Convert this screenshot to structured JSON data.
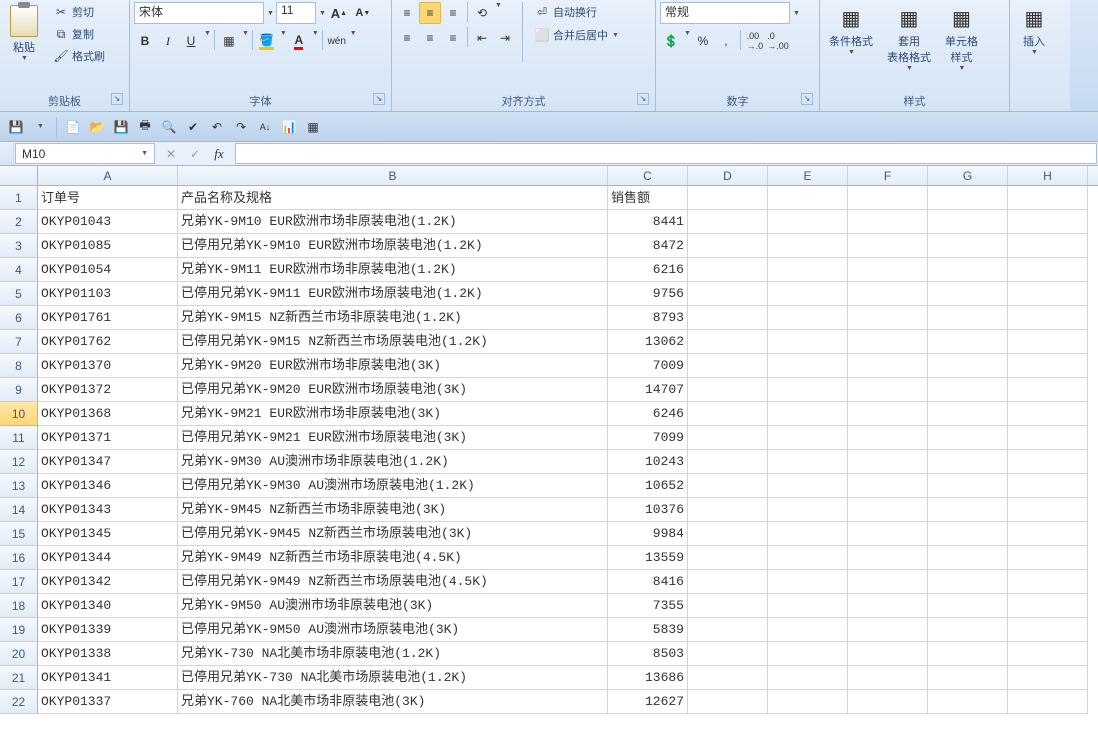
{
  "ribbon": {
    "clipboard": {
      "label": "剪贴板",
      "paste": "粘贴",
      "cut": "剪切",
      "copy": "复制",
      "format_painter": "格式刷"
    },
    "font": {
      "label": "字体",
      "name": "宋体",
      "size": "11"
    },
    "alignment": {
      "label": "对齐方式",
      "wrap": "自动换行",
      "merge": "合并后居中"
    },
    "number": {
      "label": "数字",
      "format": "常规"
    },
    "styles": {
      "label": "样式",
      "cond": "条件格式",
      "table": "套用\n表格格式",
      "cell": "单元格\n样式"
    },
    "insert": {
      "label": "插入"
    }
  },
  "namebox": "M10",
  "columns": [
    "A",
    "B",
    "C",
    "D",
    "E",
    "F",
    "G",
    "H"
  ],
  "selected_row": 10,
  "selected_col": -1,
  "rows": [
    {
      "n": 1,
      "a": "订单号",
      "b": "产品名称及规格",
      "c": "销售额",
      "c_num": false
    },
    {
      "n": 2,
      "a": "OKYP01043",
      "b": "兄弟YK-9M10 EUR欧洲市场非原装电池(1.2K)",
      "c": "8441"
    },
    {
      "n": 3,
      "a": "OKYP01085",
      "b": "已停用兄弟YK-9M10 EUR欧洲市场原装电池(1.2K)",
      "c": "8472"
    },
    {
      "n": 4,
      "a": "OKYP01054",
      "b": "兄弟YK-9M11 EUR欧洲市场非原装电池(1.2K)",
      "c": "6216"
    },
    {
      "n": 5,
      "a": "OKYP01103",
      "b": "已停用兄弟YK-9M11 EUR欧洲市场原装电池(1.2K)",
      "c": "9756"
    },
    {
      "n": 6,
      "a": "OKYP01761",
      "b": "兄弟YK-9M15 NZ新西兰市场非原装电池(1.2K)",
      "c": "8793"
    },
    {
      "n": 7,
      "a": "OKYP01762",
      "b": "已停用兄弟YK-9M15 NZ新西兰市场原装电池(1.2K)",
      "c": "13062"
    },
    {
      "n": 8,
      "a": "OKYP01370",
      "b": "兄弟YK-9M20 EUR欧洲市场非原装电池(3K)",
      "c": "7009"
    },
    {
      "n": 9,
      "a": "OKYP01372",
      "b": "已停用兄弟YK-9M20 EUR欧洲市场原装电池(3K)",
      "c": "14707"
    },
    {
      "n": 10,
      "a": "OKYP01368",
      "b": "兄弟YK-9M21 EUR欧洲市场非原装电池(3K)",
      "c": "6246"
    },
    {
      "n": 11,
      "a": "OKYP01371",
      "b": "已停用兄弟YK-9M21 EUR欧洲市场原装电池(3K)",
      "c": "7099"
    },
    {
      "n": 12,
      "a": "OKYP01347",
      "b": "兄弟YK-9M30 AU澳洲市场非原装电池(1.2K)",
      "c": "10243"
    },
    {
      "n": 13,
      "a": "OKYP01346",
      "b": "已停用兄弟YK-9M30 AU澳洲市场原装电池(1.2K)",
      "c": "10652"
    },
    {
      "n": 14,
      "a": "OKYP01343",
      "b": "兄弟YK-9M45 NZ新西兰市场非原装电池(3K)",
      "c": "10376"
    },
    {
      "n": 15,
      "a": "OKYP01345",
      "b": "已停用兄弟YK-9M45 NZ新西兰市场原装电池(3K)",
      "c": "9984"
    },
    {
      "n": 16,
      "a": "OKYP01344",
      "b": "兄弟YK-9M49 NZ新西兰市场非原装电池(4.5K)",
      "c": "13559"
    },
    {
      "n": 17,
      "a": "OKYP01342",
      "b": "已停用兄弟YK-9M49 NZ新西兰市场原装电池(4.5K)",
      "c": "8416"
    },
    {
      "n": 18,
      "a": "OKYP01340",
      "b": "兄弟YK-9M50 AU澳洲市场非原装电池(3K)",
      "c": "7355"
    },
    {
      "n": 19,
      "a": "OKYP01339",
      "b": "已停用兄弟YK-9M50 AU澳洲市场原装电池(3K)",
      "c": "5839"
    },
    {
      "n": 20,
      "a": "OKYP01338",
      "b": "兄弟YK-730 NA北美市场非原装电池(1.2K)",
      "c": "8503"
    },
    {
      "n": 21,
      "a": "OKYP01341",
      "b": "已停用兄弟YK-730 NA北美市场原装电池(1.2K)",
      "c": "13686"
    },
    {
      "n": 22,
      "a": "OKYP01337",
      "b": "兄弟YK-760 NA北美市场非原装电池(3K)",
      "c": "12627"
    }
  ]
}
